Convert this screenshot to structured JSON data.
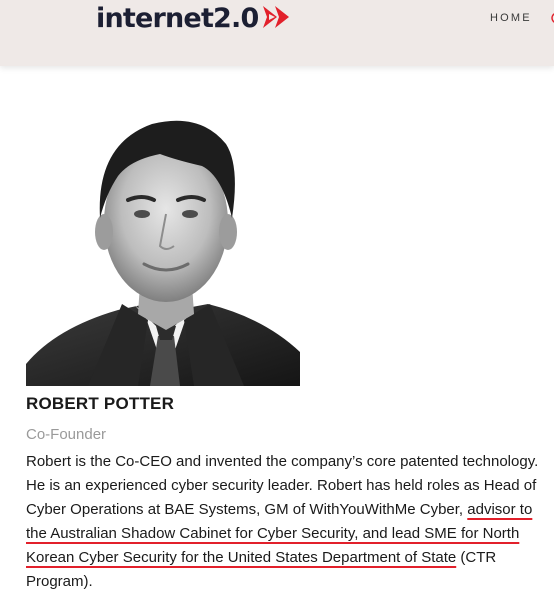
{
  "header": {
    "logo_text": "internet2.0",
    "nav_home": "HOME",
    "accent_color": "#e2202b",
    "logo_color": "#1c1f33"
  },
  "profile": {
    "photo_icon": "headshot-portrait",
    "name": "ROBERT POTTER",
    "role": "Co-Founder",
    "bio_plain": "Robert is the Co-CEO and invented the company’s core patented technology. He is an experienced cyber security leader. Robert has held roles as Head of Cyber Operations at BAE Systems, GM of WithYouWithMe Cyber, ",
    "bio_highlight": "advisor to the Australian Shadow Cabinet for Cyber Security, and lead SME for North Korean Cyber Security for the United States Department of State",
    "bio_end": " (CTR Program)."
  }
}
